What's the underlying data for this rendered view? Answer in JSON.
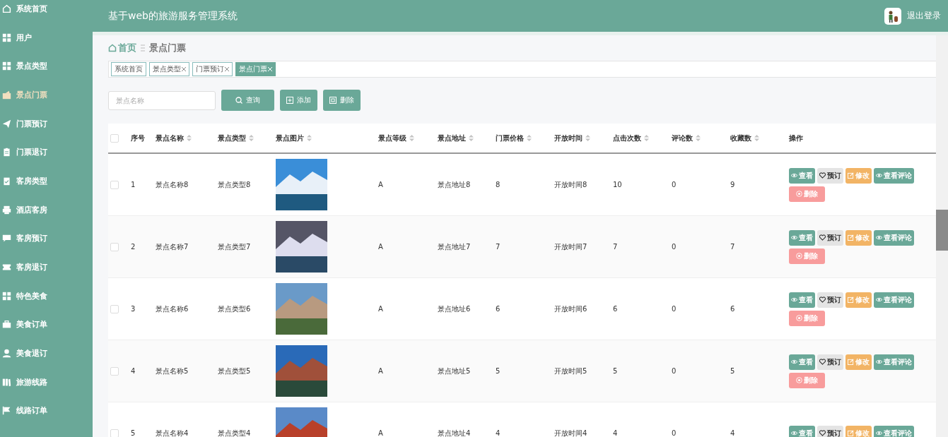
{
  "header": {
    "title": "基于web的旅游服务管理系统",
    "logout": "退出登录"
  },
  "sidebar": {
    "items": [
      {
        "label": "系统首页",
        "selected": false
      },
      {
        "label": "用户",
        "selected": false
      },
      {
        "label": "景点类型",
        "selected": false
      },
      {
        "label": "景点门票",
        "selected": true
      },
      {
        "label": "门票预订",
        "selected": false
      },
      {
        "label": "门票退订",
        "selected": false
      },
      {
        "label": "客房类型",
        "selected": false
      },
      {
        "label": "酒店客房",
        "selected": false
      },
      {
        "label": "客房预订",
        "selected": false
      },
      {
        "label": "客房退订",
        "selected": false
      },
      {
        "label": "特色美食",
        "selected": false
      },
      {
        "label": "美食订单",
        "selected": false
      },
      {
        "label": "美食退订",
        "selected": false
      },
      {
        "label": "旅游线路",
        "selected": false
      },
      {
        "label": "线路订单",
        "selected": false
      }
    ]
  },
  "breadcrumb": {
    "home": "首页",
    "current": "景点门票"
  },
  "tags": [
    {
      "label": "系统首页",
      "closable": false,
      "selected": false
    },
    {
      "label": "景点类型",
      "closable": true,
      "selected": false
    },
    {
      "label": "门票预订",
      "closable": true,
      "selected": false
    },
    {
      "label": "景点门票",
      "closable": true,
      "selected": true
    }
  ],
  "search": {
    "placeholder": "景点名称"
  },
  "toolbar": [
    {
      "label": "查询",
      "kind": "search"
    },
    {
      "label": "添加",
      "kind": "add"
    },
    {
      "label": "删除",
      "kind": "delete"
    }
  ],
  "table": {
    "all_checked": false,
    "columns": [
      {
        "label": "序号",
        "sortable": false
      },
      {
        "label": "景点名称",
        "sortable": true
      },
      {
        "label": "景点类型",
        "sortable": true
      },
      {
        "label": "景点图片",
        "sortable": true
      },
      {
        "label": "景点等级",
        "sortable": true
      },
      {
        "label": "景点地址",
        "sortable": true
      },
      {
        "label": "门票价格",
        "sortable": true
      },
      {
        "label": "开放时间",
        "sortable": true
      },
      {
        "label": "点击次数",
        "sortable": true
      },
      {
        "label": "评论数",
        "sortable": true
      },
      {
        "label": "收藏数",
        "sortable": true
      },
      {
        "label": "操作",
        "sortable": false
      }
    ],
    "rows": [
      {
        "checked": false,
        "cells": [
          "1",
          "景点名称8",
          "景点类型8",
          "",
          "A",
          "景点地址8",
          "8",
          "开放时间8",
          "10",
          "0",
          "9"
        ],
        "actions": [
          "查看",
          "预订",
          "修改",
          "查看评论",
          "删除"
        ]
      },
      {
        "checked": false,
        "cells": [
          "2",
          "景点名称7",
          "景点类型7",
          "",
          "A",
          "景点地址7",
          "7",
          "开放时间7",
          "7",
          "0",
          "7"
        ],
        "actions": [
          "查看",
          "预订",
          "修改",
          "查看评论",
          "删除"
        ]
      },
      {
        "checked": false,
        "cells": [
          "3",
          "景点名称6",
          "景点类型6",
          "",
          "A",
          "景点地址6",
          "6",
          "开放时间6",
          "6",
          "0",
          "6"
        ],
        "actions": [
          "查看",
          "预订",
          "修改",
          "查看评论",
          "删除"
        ]
      },
      {
        "checked": false,
        "cells": [
          "4",
          "景点名称5",
          "景点类型5",
          "",
          "A",
          "景点地址5",
          "5",
          "开放时间5",
          "5",
          "0",
          "5"
        ],
        "actions": [
          "查看",
          "预订",
          "修改",
          "查看评论",
          "删除"
        ]
      },
      {
        "checked": false,
        "cells": [
          "5",
          "景点名称4",
          "景点类型4",
          "",
          "A",
          "景点地址4",
          "4",
          "开放时间4",
          "4",
          "0",
          "4"
        ],
        "actions": [
          "查看",
          "预订",
          "修改",
          "查看评论"
        ]
      }
    ]
  }
}
